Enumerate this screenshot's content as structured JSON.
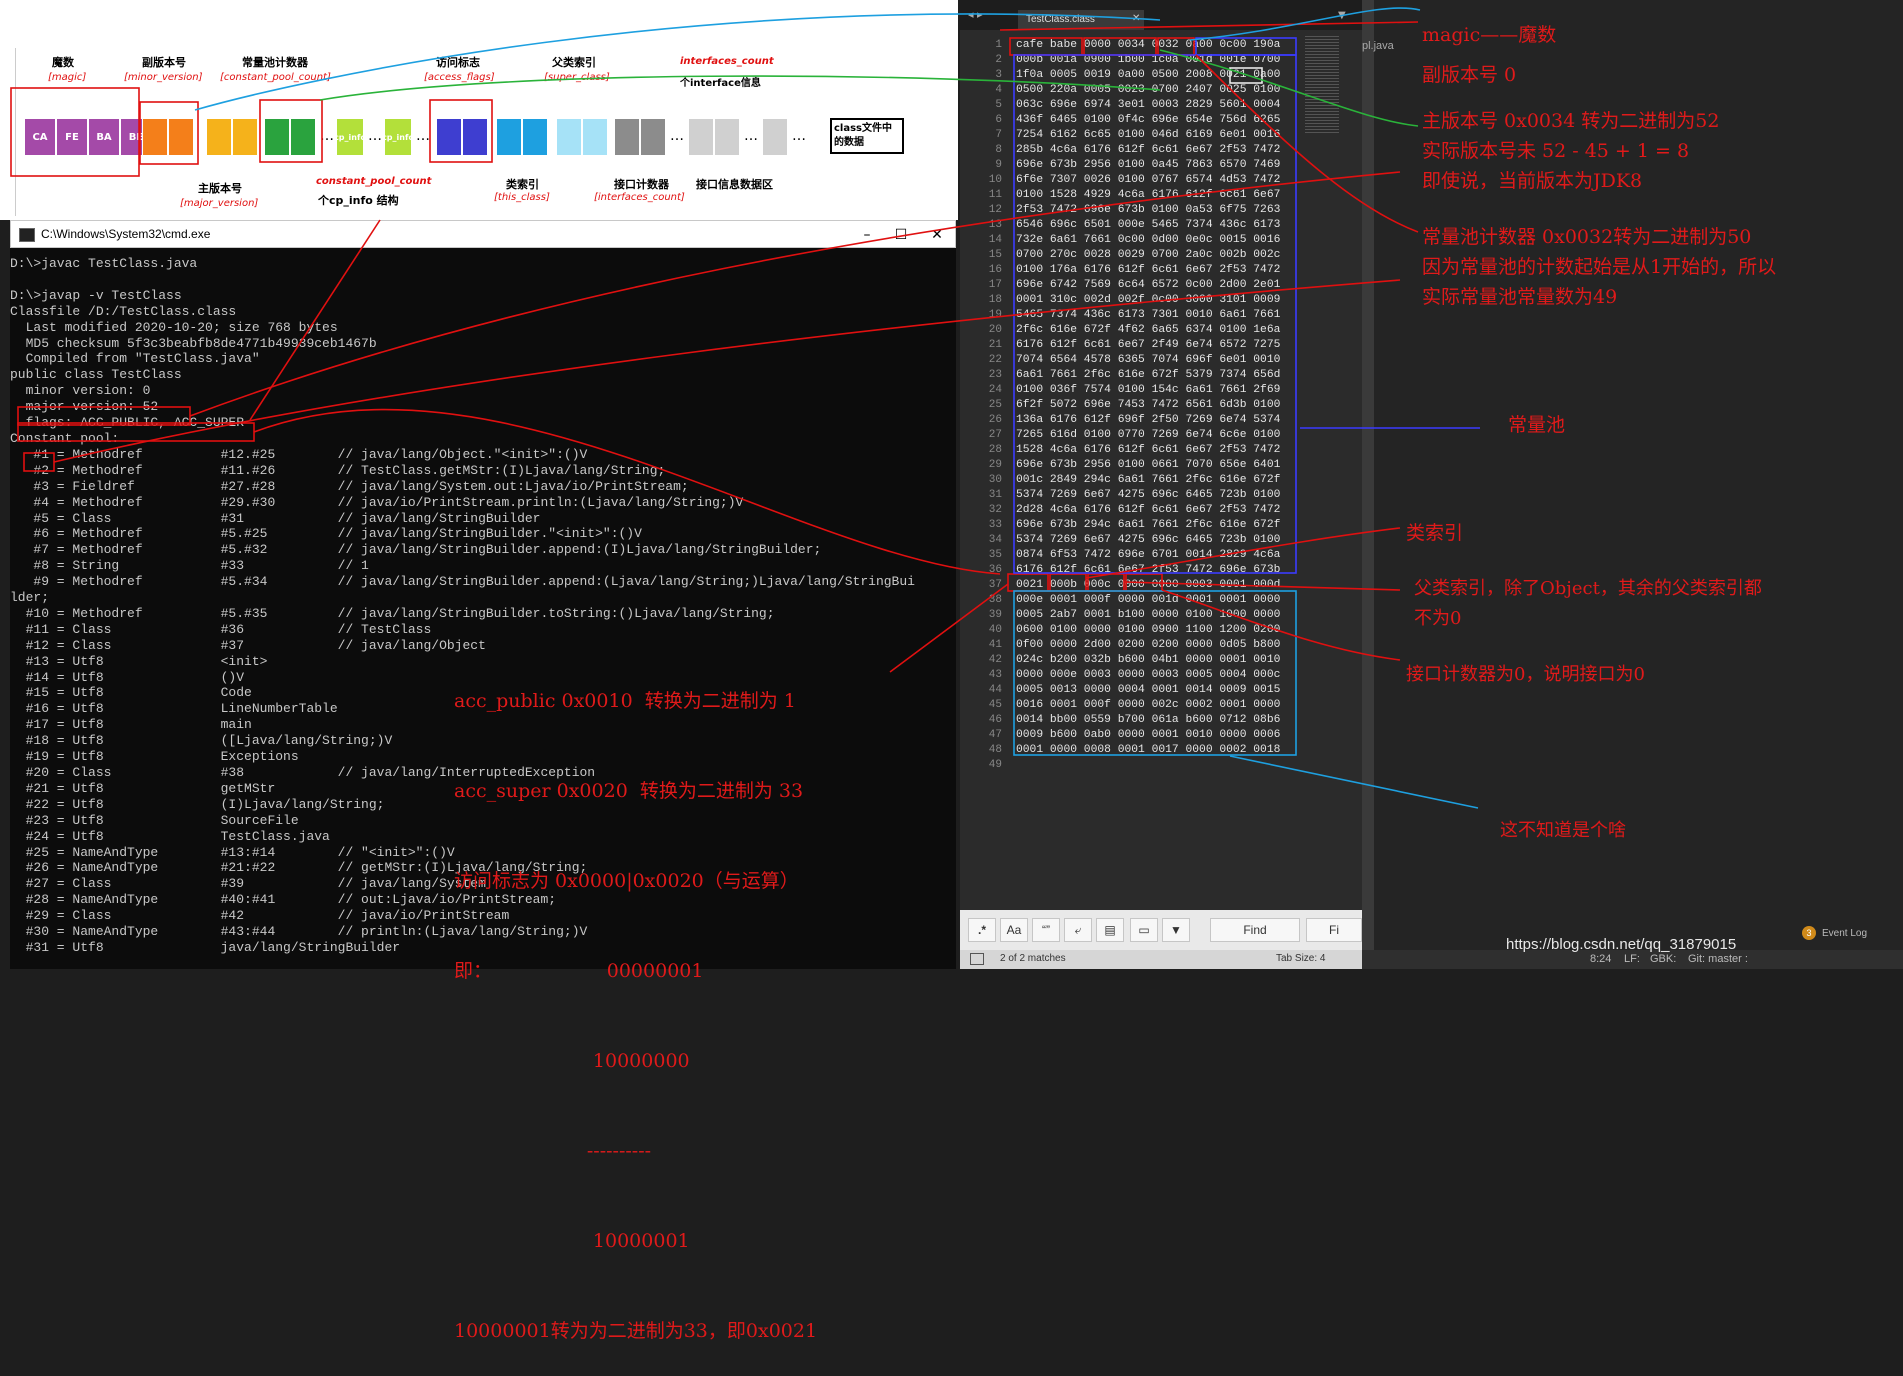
{
  "diagram": {
    "labels": {
      "magic": "魔数",
      "magic_sub": "[magic]",
      "minor": "副版本号",
      "minor_sub": "[minor_version]",
      "cp_count": "常量池计数器",
      "cp_count_sub": "[constant_pool_count]",
      "access": "访问标志",
      "access_sub": "[access_flags]",
      "super": "父类索引",
      "super_sub": "[super_class]",
      "interfaces_count": "interfaces_count",
      "interfaces_count_sub": "个interface信息",
      "major": "主版本号",
      "major_sub": "[major_version]",
      "cp_count2": "constant_pool_count",
      "cp_struct": "个cp_info 结构",
      "this": "类索引",
      "this_sub": "[this_class]",
      "iface_counter": "接口计数器",
      "iface_counter_sub": "[interfaces_count]",
      "iface_data": "接口信息数据区",
      "class_data": "class文件中的数据"
    },
    "magic_cells": [
      "CA",
      "FE",
      "BA",
      "BE"
    ],
    "cp_info": "cp_info"
  },
  "cmd": {
    "title": "C:\\Windows\\System32\\cmd.exe",
    "lines": [
      "D:\\>javac TestClass.java",
      "",
      "D:\\>javap -v TestClass",
      "Classfile /D:/TestClass.class",
      "  Last modified 2020-10-20; size 768 bytes",
      "  MD5 checksum 5f3c3beabfb8de4771b49939ceb1467b",
      "  Compiled from \"TestClass.java\"",
      "public class TestClass",
      "  minor version: 0",
      "  major version: 52",
      "  flags: ACC_PUBLIC, ACC_SUPER",
      "Constant pool:",
      "   #1 = Methodref          #12.#25        // java/lang/Object.\"<init>\":()V",
      "   #2 = Methodref          #11.#26        // TestClass.getMStr:(I)Ljava/lang/String;",
      "   #3 = Fieldref           #27.#28        // java/lang/System.out:Ljava/io/PrintStream;",
      "   #4 = Methodref          #29.#30        // java/io/PrintStream.println:(Ljava/lang/String;)V",
      "   #5 = Class              #31            // java/lang/StringBuilder",
      "   #6 = Methodref          #5.#25         // java/lang/StringBuilder.\"<init>\":()V",
      "   #7 = Methodref          #5.#32         // java/lang/StringBuilder.append:(I)Ljava/lang/StringBuilder;",
      "   #8 = String             #33            // 1",
      "   #9 = Methodref          #5.#34         // java/lang/StringBuilder.append:(Ljava/lang/String;)Ljava/lang/StringBui",
      "lder;",
      "  #10 = Methodref          #5.#35         // java/lang/StringBuilder.toString:()Ljava/lang/String;",
      "  #11 = Class              #36            // TestClass",
      "  #12 = Class              #37            // java/lang/Object",
      "  #13 = Utf8               <init>",
      "  #14 = Utf8               ()V",
      "  #15 = Utf8               Code",
      "  #16 = Utf8               LineNumberTable",
      "  #17 = Utf8               main",
      "  #18 = Utf8               ([Ljava/lang/String;)V",
      "  #19 = Utf8               Exceptions",
      "  #20 = Class              #38            // java/lang/InterruptedException",
      "  #21 = Utf8               getMStr",
      "  #22 = Utf8               (I)Ljava/lang/String;",
      "  #23 = Utf8               SourceFile",
      "  #24 = Utf8               TestClass.java",
      "  #25 = NameAndType        #13:#14        // \"<init>\":()V",
      "  #26 = NameAndType        #21:#22        // getMStr:(I)Ljava/lang/String;",
      "  #27 = Class              #39            // java/lang/System",
      "  #28 = NameAndType        #40:#41        // out:Ljava/io/PrintStream;",
      "  #29 = Class              #42            // java/io/PrintStream",
      "  #30 = NameAndType        #43:#44        // println:(Ljava/lang/String;)V",
      "  #31 = Utf8               java/lang/StringBuilder"
    ],
    "annotation": [
      "acc_public 0x0010  转换为二进制为 1",
      "acc_super 0x0020  转换为二进制为 33",
      "访问标志为 0x0000|0x0020（与运算）",
      "即：                   00000001",
      "                       10000000",
      "                      ----------",
      "                       10000001",
      "10000001转为为二进制为33，即0x0021"
    ]
  },
  "editor": {
    "tab_label": "TestClass.class",
    "hex_lines": [
      "cafe babe 0000 0034 0032 0a00 0c00 190a",
      "000b 001a 0900 1b00 1c0a 001d 001e 0700",
      "1f0a 0005 0019 0a00 0500 2008 0021 0a00",
      "0500 220a 0005 0023 0700 2407 0025 0100",
      "063c 696e 6974 3e01 0003 2829 5601 0004",
      "436f 6465 0100 0f4c 696e 654e 756d 6265",
      "7254 6162 6c65 0100 046d 6169 6e01 0016",
      "285b 4c6a 6176 612f 6c61 6e67 2f53 7472",
      "696e 673b 2956 0100 0a45 7863 6570 7469",
      "6f6e 7307 0026 0100 0767 6574 4d53 7472",
      "0100 1528 4929 4c6a 6176 612f 6c61 6e67",
      "2f53 7472 696e 673b 0100 0a53 6f75 7263",
      "6546 696c 6501 000e 5465 7374 436c 6173",
      "732e 6a61 7661 0c00 0d00 0e0c 0015 0016",
      "0700 270c 0028 0029 0700 2a0c 002b 002c",
      "0100 176a 6176 612f 6c61 6e67 2f53 7472",
      "696e 6742 7569 6c64 6572 0c00 2d00 2e01",
      "0001 310c 002d 002f 0c00 3000 3101 0009",
      "5465 7374 436c 6173 7301 0010 6a61 7661",
      "2f6c 616e 672f 4f62 6a65 6374 0100 1e6a",
      "6176 612f 6c61 6e67 2f49 6e74 6572 7275",
      "7074 6564 4578 6365 7074 696f 6e01 0010",
      "6a61 7661 2f6c 616e 672f 5379 7374 656d",
      "0100 036f 7574 0100 154c 6a61 7661 2f69",
      "6f2f 5072 696e 7453 7472 6561 6d3b 0100",
      "136a 6176 612f 696f 2f50 7269 6e74 5374",
      "7265 616d 0100 0770 7269 6e74 6c6e 0100",
      "1528 4c6a 6176 612f 6c61 6e67 2f53 7472",
      "696e 673b 2956 0100 0661 7070 656e 6401",
      "001c 2849 294c 6a61 7661 2f6c 616e 672f",
      "5374 7269 6e67 4275 696c 6465 723b 0100",
      "2d28 4c6a 6176 612f 6c61 6e67 2f53 7472",
      "696e 673b 294c 6a61 7661 2f6c 616e 672f",
      "5374 7269 6e67 4275 696c 6465 723b 0100",
      "0874 6f53 7472 696e 6701 0014 2829 4c6a",
      "6176 612f 6c61 6e67 2f53 7472 696e 673b",
      "0021 000b 000c 0000 0000 0003 0001 000d",
      "000e 0001 000f 0000 001d 0001 0001 0000",
      "0005 2ab7 0001 b100 0000 0100 1000 0000",
      "0600 0100 0000 0100 0900 1100 1200 0200",
      "0f00 0000 2d00 0200 0200 0000 0d05 b800",
      "024c b200 032b b600 04b1 0000 0001 0010",
      "0000 000e 0003 0000 0003 0005 0004 000c",
      "0005 0013 0000 0004 0001 0014 0009 0015",
      "0016 0001 000f 0000 002c 0002 0001 0000",
      "0014 bb00 0559 b700 061a b600 0712 08b6",
      "0009 b600 0ab0 0000 0001 0010 0000 0006",
      "0001 0000 0008 0001 0017 0000 0002 0018",
      ""
    ],
    "find": {
      "regex": ".*",
      "case": "Aa",
      "word": "“”",
      "find_label": "Find",
      "find_all_label": "Fi"
    },
    "status": {
      "matches": "2 of 2 matches",
      "tab_size": "Tab Size: 4"
    }
  },
  "right_panel": {
    "file_tab": "pl.java",
    "annotations": {
      "magic": "magic——魔数",
      "minor": "副版本号 0",
      "major1": "主版本号 0x0034 转为二进制为52",
      "major2": "实际版本号未 52 - 45 + 1 = 8",
      "major3": "即使说，当前版本为JDK8",
      "cp1": "常量池计数器 0x0032转为二进制为50",
      "cp2": "因为常量池的计数起始是从1开始的，所以",
      "cp3": "实际常量池常量数为49",
      "pool": "常量池",
      "this_idx": "类索引",
      "super1": "父类索引，除了Object，其余的父类索引都",
      "super2": "不为0",
      "iface": "接口计数器为0，说明接口为0",
      "unknown": "这不知道是个啥"
    },
    "status": {
      "pos": "8:24",
      "lf": "LF:",
      "enc": "GBK:",
      "git": "Git: master :",
      "watermark": "https://blog.csdn.net/qq_31879015",
      "event_log": "Event Log",
      "badge": "3"
    }
  }
}
